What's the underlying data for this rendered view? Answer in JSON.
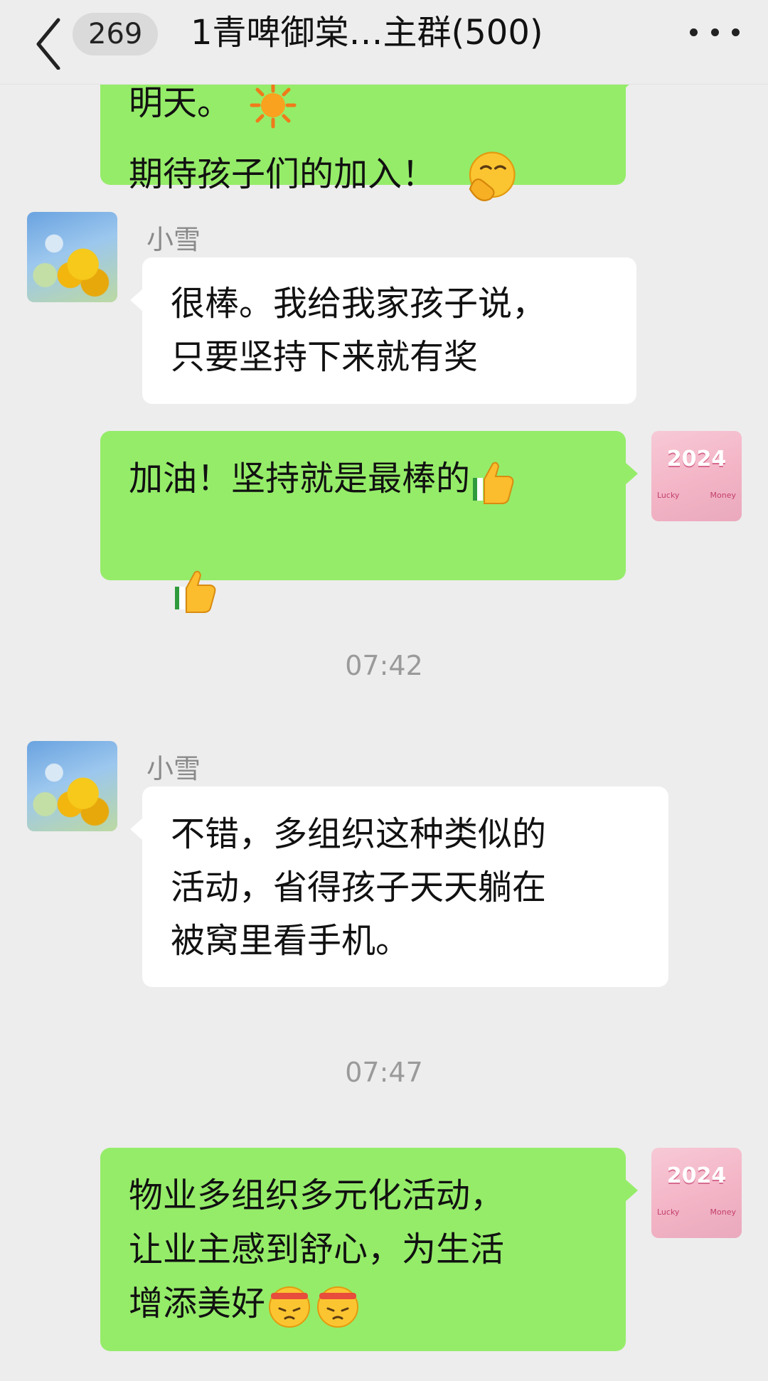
{
  "header": {
    "unread_count": "269",
    "title": "1青啤御棠…主群(500)"
  },
  "messages": [
    {
      "text_line1": "明天。",
      "text_line2": "期待孩子们的加入！"
    },
    {
      "sender": "小雪",
      "text": "很棒。我给我家孩子说，\n只要坚持下来就有奖"
    },
    {
      "text": "加油！坚持就是最棒的"
    },
    {
      "time": "07:42"
    },
    {
      "sender": "小雪",
      "text": "不错，多组织这种类似的\n活动，省得孩子天天躺在\n被窝里看手机。"
    },
    {
      "time": "07:47"
    },
    {
      "text_line1": "物业多组织多元化活动，",
      "text_line2": "让业主感到舒心，为生活",
      "text_line3": "增添美好"
    }
  ],
  "avatars": {
    "self": {
      "year": "2024",
      "left_text": "Lucky",
      "right_text": "Money"
    }
  },
  "colors": {
    "background": "#ededed",
    "mine_bubble": "#95ec69",
    "theirs_bubble": "#ffffff"
  },
  "icons": {
    "back": "chevron-left-icon",
    "more": "more-dots-icon",
    "emoji_1": "sun-emoji",
    "emoji_2": "hand-over-mouth-emoji",
    "emoji_3": "thumbs-up-emoji",
    "emoji_4": "determined-headband-emoji"
  }
}
